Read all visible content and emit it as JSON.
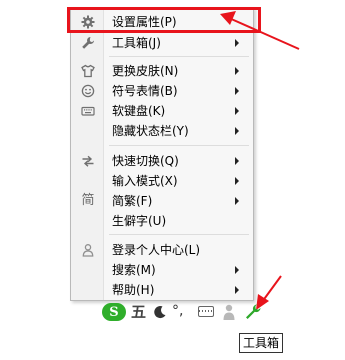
{
  "menu": {
    "items": [
      {
        "label": "设置属性(P)",
        "icon": "gear-icon",
        "submenu": false
      },
      {
        "label": "工具箱(J)",
        "icon": "wrench-icon",
        "submenu": true
      },
      {
        "label": "更换皮肤(N)",
        "icon": "shirt-icon",
        "submenu": true
      },
      {
        "label": "符号表情(B)",
        "icon": "smiley-icon",
        "submenu": true
      },
      {
        "label": "软键盘(K)",
        "icon": "keyboard-icon",
        "submenu": true
      },
      {
        "label": "隐藏状态栏(Y)",
        "icon": "",
        "submenu": true
      },
      {
        "label": "快速切换(Q)",
        "icon": "switch-arrows-icon",
        "submenu": true
      },
      {
        "label": "输入模式(X)",
        "icon": "",
        "submenu": true
      },
      {
        "label": "简繁(F)",
        "icon": "simplified-char-icon",
        "icon_glyph": "简",
        "submenu": true
      },
      {
        "label": "生僻字(U)",
        "icon": "",
        "submenu": false
      },
      {
        "label": "登录个人中心(L)",
        "icon": "user-icon",
        "submenu": false
      },
      {
        "label": "搜索(M)",
        "icon": "",
        "submenu": true
      },
      {
        "label": "帮助(H)",
        "icon": "",
        "submenu": true
      }
    ]
  },
  "statusbar": {
    "logo": "S",
    "mode": "五",
    "punct": "°,",
    "icons": [
      "sogou-logo-icon",
      "moon-icon",
      "punctuation-icon",
      "keyboard-icon",
      "user-icon",
      "wrench-icon"
    ]
  },
  "tooltip": {
    "text": "工具箱"
  },
  "colors": {
    "highlight_red": "#e8141c",
    "logo_green": "#2fae2b",
    "wrench_green": "#2ea82a"
  }
}
